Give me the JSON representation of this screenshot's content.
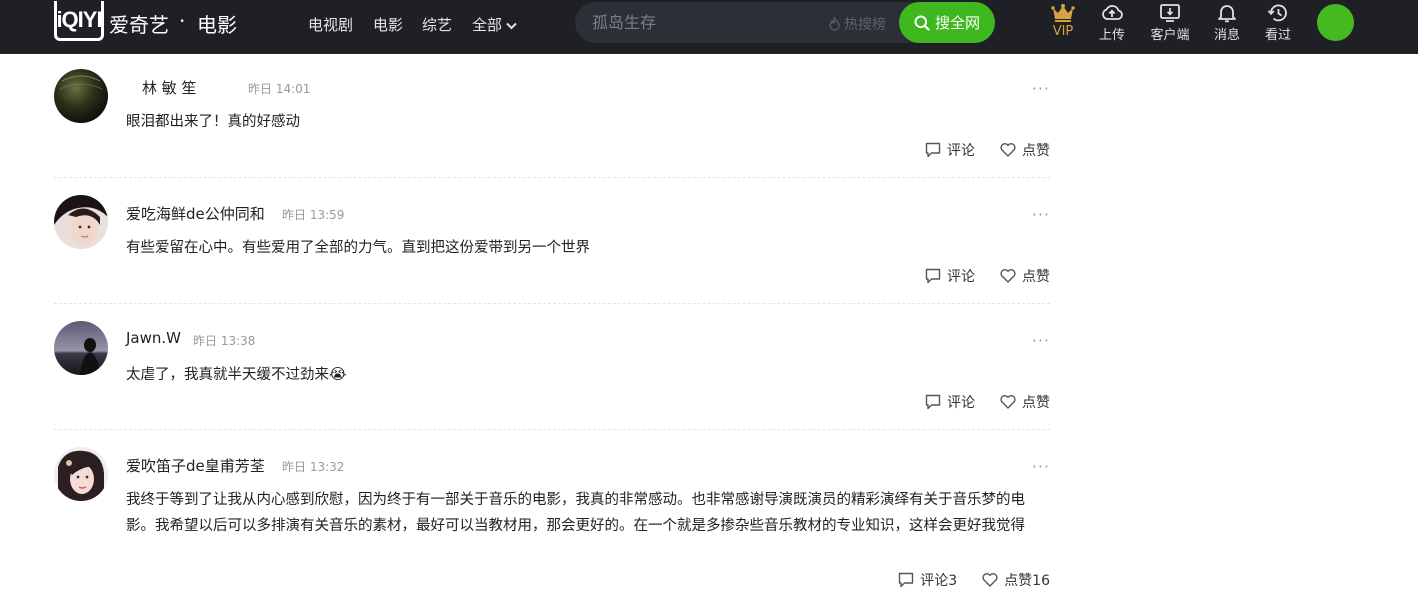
{
  "header": {
    "logo_text": "iQIYI",
    "brand": "爱奇艺",
    "separator": "·",
    "channel": "电影",
    "nav": [
      "电视剧",
      "电影",
      "综艺",
      "全部"
    ],
    "search": {
      "placeholder": "孤岛生存",
      "hot_label": "热搜榜",
      "button_label": "搜全网"
    },
    "tools": [
      {
        "icon": "crown-icon",
        "label": "VIP"
      },
      {
        "icon": "upload-icon",
        "label": "上传"
      },
      {
        "icon": "client-download-icon",
        "label": "客户端"
      },
      {
        "icon": "bell-icon",
        "label": "消息"
      },
      {
        "icon": "history-icon",
        "label": "看过"
      }
    ],
    "colors": {
      "bar": "#1e2025",
      "accent": "#3fb71e",
      "vip": "#d6a243"
    }
  },
  "comments": [
    {
      "name": "林 敏 笙",
      "time": "昨日 14:01",
      "text": "眼泪都出来了！真的好感动",
      "comment_label": "评论",
      "like_label": "点赞"
    },
    {
      "name": "爱吃海鲜de公仲同和",
      "time": "昨日 13:59",
      "text": "有些爱留在心中。有些爱用了全部的力气。直到把这份爱带到另一个世界",
      "comment_label": "评论",
      "like_label": "点赞"
    },
    {
      "name": "Jawn.W",
      "time": "昨日 13:38",
      "text": "太虐了，我真就半天缓不过劲来",
      "emoji": "😭",
      "comment_label": "评论",
      "like_label": "点赞"
    },
    {
      "name": "爱吹笛子de皇甫芳荃",
      "time": "昨日 13:32",
      "text": "我终于等到了让我从内心感到欣慰，因为终于有一部关于音乐的电影，我真的非常感动。也非常感谢导演既演员的精彩演绎有关于音乐梦的电影。我希望以后可以多排演有关音乐的素材，最好可以当教材用，那会更好的。在一个就是多掺杂些音乐教材的专业知识，这样会更好我觉得",
      "comment_label": "评论3",
      "like_label": "点赞16"
    }
  ],
  "more_label": "···"
}
